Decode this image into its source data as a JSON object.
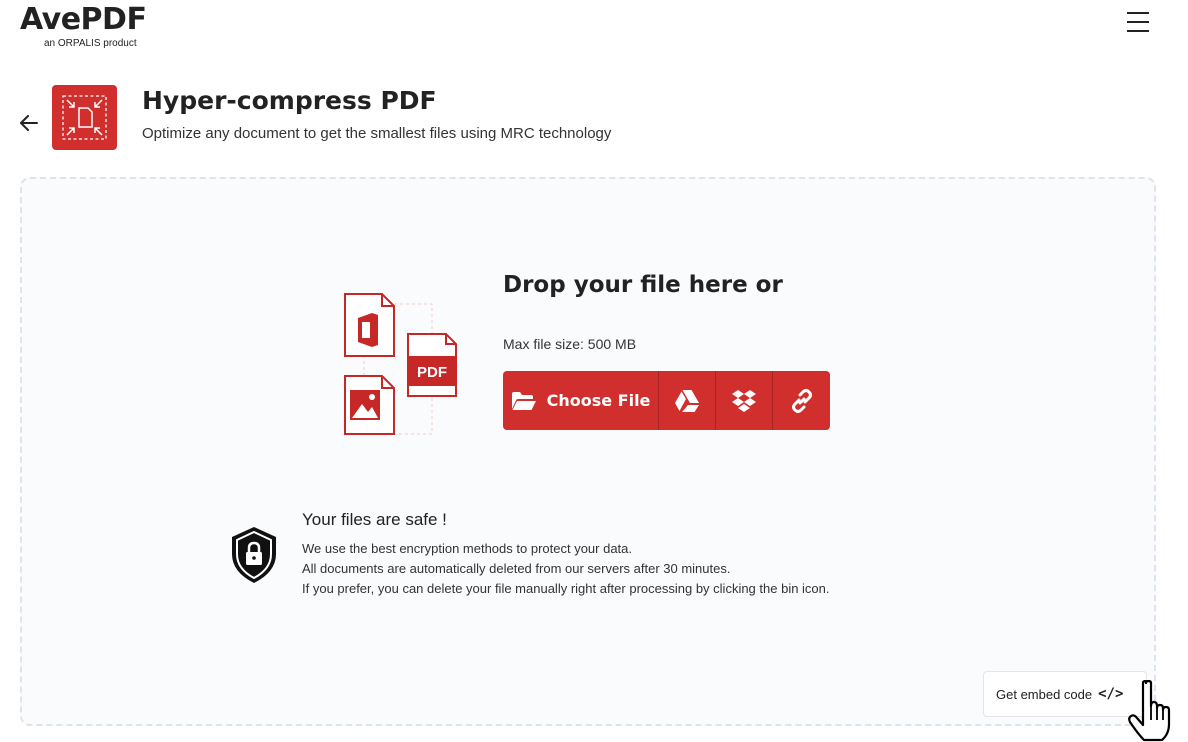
{
  "header": {
    "logo_text": "AvePDF",
    "logo_sub": "an ORPALIS product",
    "menu_icon": "hamburger-menu-icon"
  },
  "tool": {
    "title": "Hyper-compress PDF",
    "subtitle": "Optimize any document to get the smallest files using MRC technology",
    "icon": "compress-document-icon",
    "accent_color": "#d12e2e"
  },
  "upload": {
    "drop_title": "Drop your file here or",
    "max_size": "Max file size: 500 MB",
    "choose_label": "Choose File",
    "illustration_badge": "PDF",
    "sources": [
      "google-drive-icon",
      "dropbox-icon",
      "link-icon"
    ]
  },
  "safety": {
    "title": "Your files are safe !",
    "lines": [
      "We use the best encryption methods to protect your data.",
      "All documents are automatically deleted from our servers after 30 minutes.",
      "If you prefer, you can delete your file manually right after processing by clicking the bin icon."
    ]
  },
  "embed": {
    "label": "Get embed code",
    "code_glyph": "</>"
  }
}
